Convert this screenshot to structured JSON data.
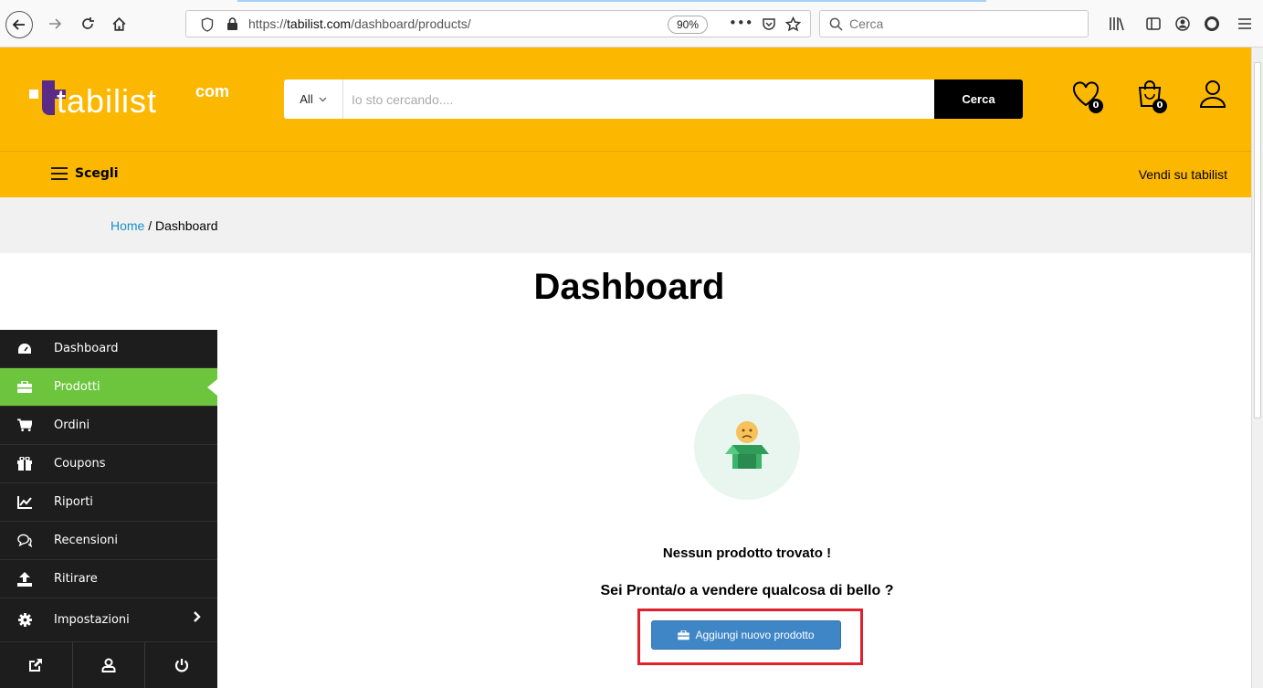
{
  "browser": {
    "url_prefix": "https://",
    "url_host": "tabilist.com",
    "url_path": "/dashboard/products/",
    "zoom": "90%",
    "search_placeholder": "Cerca"
  },
  "header": {
    "logo_text": "tabilist",
    "logo_suffix": "com",
    "category": "All",
    "search_placeholder": "Io sto cercando....",
    "search_button": "Cerca",
    "wishlist_count": "0",
    "cart_count": "0",
    "brand_color": "#fcb800"
  },
  "nav": {
    "menu_label": "Scegli",
    "sell_link": "Vendi su tabilist"
  },
  "breadcrumb": {
    "home": "Home",
    "separator": " / ",
    "current": "Dashboard"
  },
  "page_title": "Dashboard",
  "sidebar": {
    "items": [
      {
        "label": "Dashboard",
        "icon": "dashboard-icon"
      },
      {
        "label": "Prodotti",
        "icon": "briefcase-icon",
        "active": true
      },
      {
        "label": "Ordini",
        "icon": "cart-icon"
      },
      {
        "label": "Coupons",
        "icon": "gift-icon"
      },
      {
        "label": "Riporti",
        "icon": "chart-icon"
      },
      {
        "label": "Recensioni",
        "icon": "comments-icon"
      },
      {
        "label": "Ritirare",
        "icon": "upload-icon"
      },
      {
        "label": "Impostazioni",
        "icon": "gear-icon"
      }
    ],
    "active_color": "#6cc53d"
  },
  "empty_state": {
    "title": "Nessun prodotto trovato !",
    "subtitle": "Sei Pronta/o a vendere qualcosa di bello ?",
    "button": "Aggiungi nuovo prodotto"
  }
}
